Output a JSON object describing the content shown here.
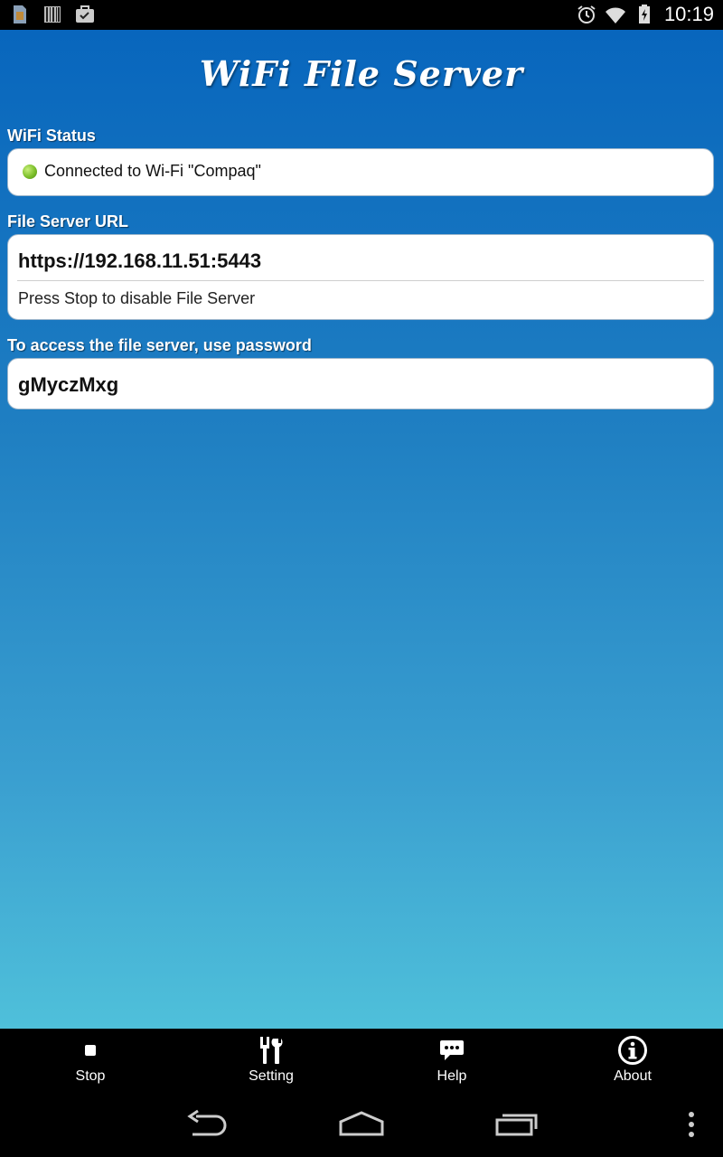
{
  "status_bar": {
    "time": "10:19",
    "left_icons": [
      "sim-card-icon",
      "barcode-icon",
      "briefcase-icon"
    ],
    "right_icons": [
      "alarm-icon",
      "wifi-icon",
      "battery-icon"
    ]
  },
  "app": {
    "title": "WiFi File Server",
    "colors": {
      "gradient_top": "#0866bd",
      "gradient_bottom": "#4fc0da",
      "status_dot": "#7cbf2a"
    }
  },
  "wifi_status": {
    "label": "WiFi Status",
    "text": "Connected to Wi-Fi \"Compaq\"",
    "indicator_icon": "green-dot-icon"
  },
  "file_server": {
    "label": "File Server URL",
    "url": "https://192.168.11.51:5443",
    "hint": "Press Stop to disable File Server"
  },
  "password": {
    "label": "To access the file server, use password",
    "value": "gMyczMxg"
  },
  "toolbar": {
    "stop": "Stop",
    "setting": "Setting",
    "help": "Help",
    "about": "About"
  },
  "nav": {
    "icons": [
      "back-icon",
      "home-icon",
      "recents-icon",
      "overflow-menu-icon"
    ]
  }
}
